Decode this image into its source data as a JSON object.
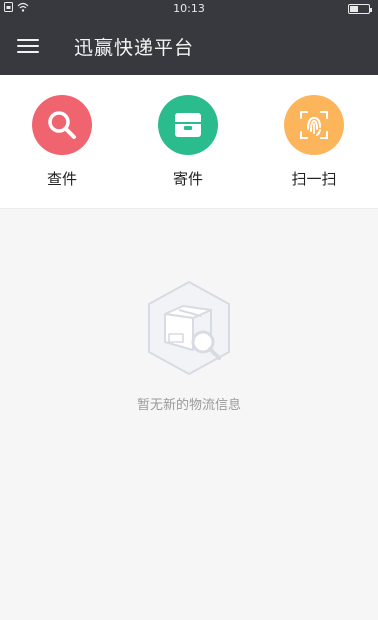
{
  "status": {
    "time": "10:13",
    "battery_level": 0.4
  },
  "appbar": {
    "title": "迅赢快递平台"
  },
  "actions": [
    {
      "label": "查件",
      "icon": "search-icon",
      "color": "#f0646f"
    },
    {
      "label": "寄件",
      "icon": "box-icon",
      "color": "#2bbc8e"
    },
    {
      "label": "扫一扫",
      "icon": "scan-fingerprint-icon",
      "color": "#fdb55b"
    }
  ],
  "empty_state": {
    "message": "暂无新的物流信息",
    "icon": "empty-package-icon"
  }
}
